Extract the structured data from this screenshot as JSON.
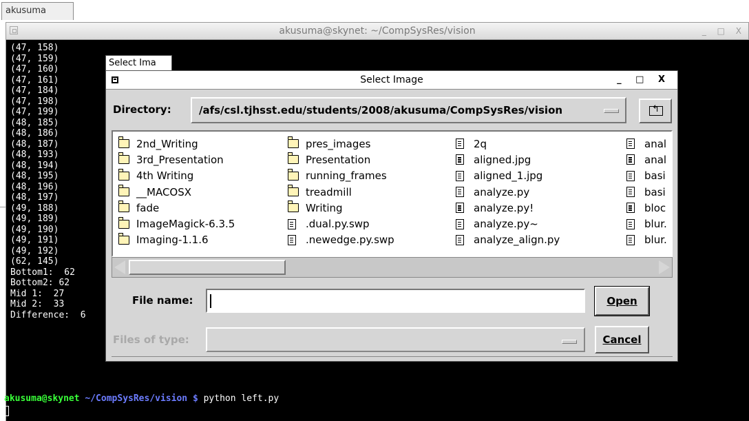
{
  "terminal": {
    "tab_label": "akusuma",
    "title": "akusuma@skynet: ~/CompSysRes/vision",
    "window_controls": "_ □ X",
    "output_lines": [
      "(47, 158)",
      "(47, 159)",
      "(47, 160)",
      "(47, 161)",
      "(47, 184)",
      "(47, 198)",
      "(47, 199)",
      "(48, 185)",
      "(48, 186)",
      "(48, 187)",
      "(48, 193)",
      "(48, 194)",
      "(48, 195)",
      "(48, 196)",
      "(48, 197)",
      "(49, 188)",
      "(49, 189)",
      "(49, 190)",
      "(49, 191)",
      "(49, 192)",
      "(62, 145)",
      "Bottom1:  62",
      "Bottom2: 62",
      "Mid 1:  27",
      "Mid 2:  33",
      "Difference:  6"
    ],
    "prompt": {
      "user_host": "akusuma@skynet",
      "path": "~/CompSysRes/vision $",
      "command": " python left.py"
    }
  },
  "dialog": {
    "tab_label": "Select Ima",
    "title": "Select Image",
    "window_controls": "_ □ X",
    "directory_label": "Directory:",
    "directory_value": "/afs/csl.tjhsst.edu/students/2008/akusuma/CompSysRes/vision",
    "file_columns": [
      [
        {
          "name": "2nd_Writing",
          "kind": "folder"
        },
        {
          "name": "3rd_Presentation",
          "kind": "folder"
        },
        {
          "name": "4th Writing",
          "kind": "folder"
        },
        {
          "name": "__MACOSX",
          "kind": "folder"
        },
        {
          "name": "fade",
          "kind": "folder"
        },
        {
          "name": "ImageMagick-6.3.5",
          "kind": "folder"
        },
        {
          "name": "Imaging-1.1.6",
          "kind": "folder"
        }
      ],
      [
        {
          "name": "pres_images",
          "kind": "folder"
        },
        {
          "name": "Presentation",
          "kind": "folder"
        },
        {
          "name": "running_frames",
          "kind": "folder"
        },
        {
          "name": "treadmill",
          "kind": "folder"
        },
        {
          "name": "Writing",
          "kind": "folder"
        },
        {
          "name": ".dual.py.swp",
          "kind": "file"
        },
        {
          "name": ".newedge.py.swp",
          "kind": "file"
        }
      ],
      [
        {
          "name": "2q",
          "kind": "file"
        },
        {
          "name": "aligned.jpg",
          "kind": "file"
        },
        {
          "name": "aligned_1.jpg",
          "kind": "file"
        },
        {
          "name": "analyze.py",
          "kind": "file"
        },
        {
          "name": "analyze.py!",
          "kind": "file"
        },
        {
          "name": "analyze.py~",
          "kind": "file"
        },
        {
          "name": "analyze_align.py",
          "kind": "file"
        }
      ],
      [
        {
          "name": "anal",
          "kind": "file"
        },
        {
          "name": "anal",
          "kind": "file"
        },
        {
          "name": "basi",
          "kind": "file"
        },
        {
          "name": "basi",
          "kind": "file"
        },
        {
          "name": "bloc",
          "kind": "file"
        },
        {
          "name": "blur.",
          "kind": "file"
        },
        {
          "name": "blur.",
          "kind": "file"
        }
      ]
    ],
    "file_name_label": "File name:",
    "file_name_value": "",
    "files_of_type_label": "Files of type:",
    "files_of_type_value": "",
    "open_label": "Open",
    "cancel_label": "Cancel"
  }
}
